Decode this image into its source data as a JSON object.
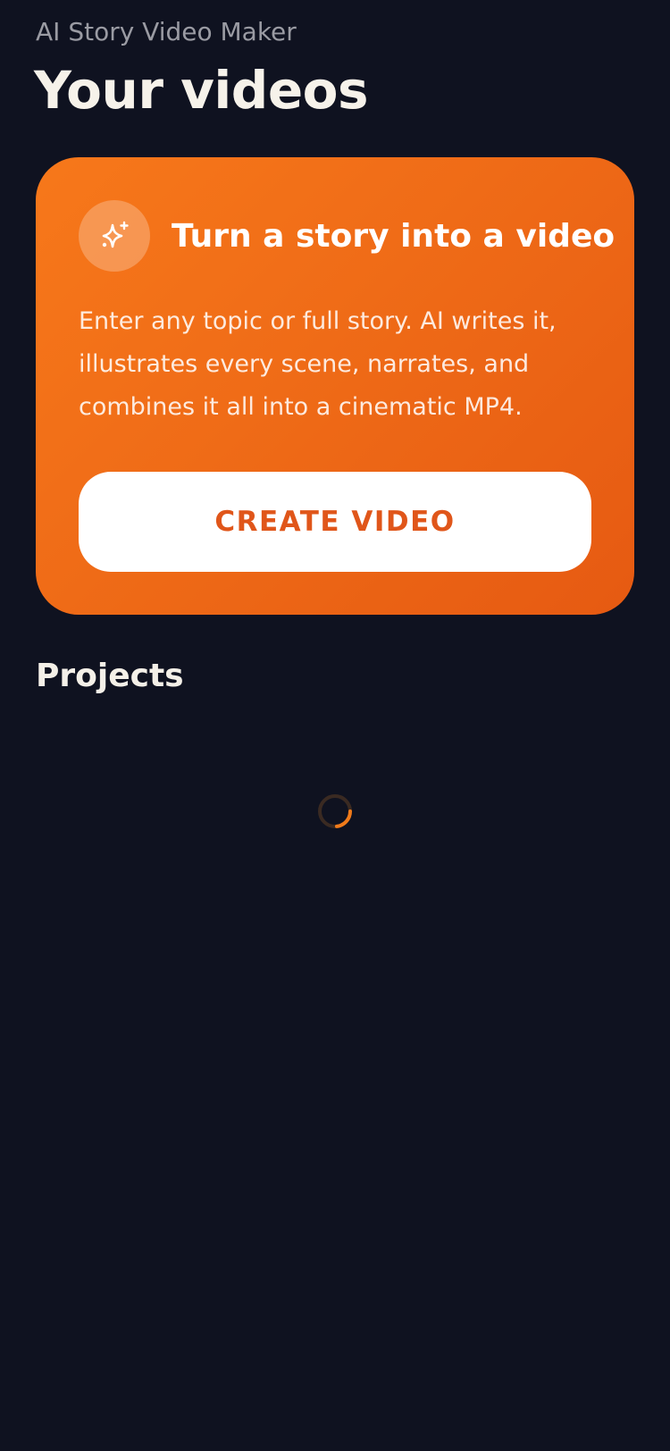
{
  "header": {
    "app_name": "AI Story Video Maker",
    "title": "Your videos"
  },
  "hero": {
    "icon": "sparkles-icon",
    "title": "Turn a story into a video",
    "description": "Enter any topic or full story. AI writes it, illustrates every scene, narrates, and combines it all into a cinematic MP4.",
    "button_label": "CREATE VIDEO"
  },
  "projects": {
    "title": "Projects",
    "loading_icon": "spinner-icon"
  },
  "colors": {
    "background": "#0f1220",
    "accent": "#f26f18",
    "accent_text": "#e0561a"
  }
}
